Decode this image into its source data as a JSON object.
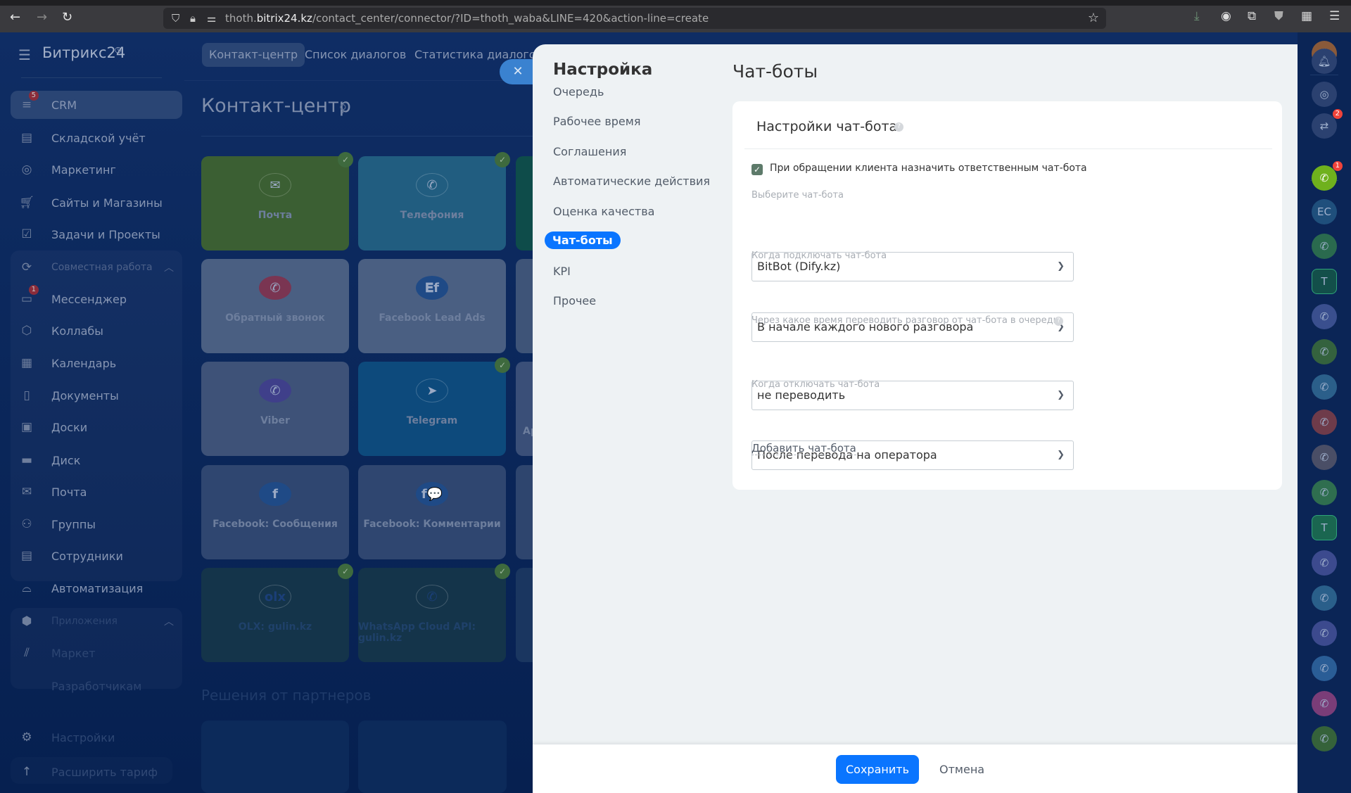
{
  "browser": {
    "url_prefix": "thoth.",
    "url_domain": "bitrix24.kz",
    "url_path": "/contact_center/connector/?ID=thoth_waba&LINE=420&action-line=create"
  },
  "sidebar": {
    "logo": "Битрикс24",
    "items": [
      {
        "label": "CRM",
        "icon": "funnel-icon",
        "badge": "5"
      },
      {
        "label": "Складской учёт",
        "icon": "warehouse-icon"
      },
      {
        "label": "Маркетинг",
        "icon": "target-icon"
      },
      {
        "label": "Сайты и Магазины",
        "icon": "cart-icon"
      },
      {
        "label": "Задачи и Проекты",
        "icon": "task-icon"
      },
      {
        "label": "Совместная работа",
        "icon": "team-icon"
      },
      {
        "label": "Мессенджер",
        "icon": "chat-icon",
        "badge": "1"
      },
      {
        "label": "Коллабы",
        "icon": "hexagon-icon"
      },
      {
        "label": "Календарь",
        "icon": "calendar-icon"
      },
      {
        "label": "Документы",
        "icon": "document-icon"
      },
      {
        "label": "Доски",
        "icon": "board-icon"
      },
      {
        "label": "Диск",
        "icon": "disk-icon"
      },
      {
        "label": "Почта",
        "icon": "mail-icon"
      },
      {
        "label": "Группы",
        "icon": "groups-icon"
      },
      {
        "label": "Сотрудники",
        "icon": "employees-icon"
      },
      {
        "label": "Автоматизация",
        "icon": "robot-icon"
      },
      {
        "label": "Приложения",
        "icon": "box-icon"
      },
      {
        "label": "Маркет",
        "icon": "market-icon"
      },
      {
        "label": "Разработчикам",
        "icon": "code-icon"
      },
      {
        "label": "Настройки",
        "icon": "gear-icon"
      },
      {
        "label": "Расширить тариф",
        "icon": "upgrade-icon"
      }
    ]
  },
  "topnav": {
    "tabs": [
      "Контакт-центр",
      "Список диалогов",
      "Статистика диалогов"
    ]
  },
  "contact_center": {
    "title": "Контакт-центр",
    "partners_title": "Решения от партнеров",
    "tiles": [
      {
        "label": "Почта",
        "color": "#3b5f33",
        "checked": true
      },
      {
        "label": "Телефония",
        "color": "#215d80",
        "checked": true
      },
      {
        "label": "Обратный звонок",
        "color": "#4a5f82",
        "checked": false
      },
      {
        "label": "Facebook Lead Ads",
        "color": "#4a5f82",
        "checked": false
      },
      {
        "label": "Viber",
        "color": "#3e5278",
        "checked": false
      },
      {
        "label": "Telegram",
        "color": "#0d4a7c",
        "checked": true
      },
      {
        "label": "Facebook: Сообщения",
        "color": "#2f4670",
        "checked": false
      },
      {
        "label": "Facebook: Комментарии",
        "color": "#2f4670",
        "checked": false
      },
      {
        "label": "OLX: gulin.kz",
        "color": "#14344a",
        "checked": true
      },
      {
        "label": "WhatsApp Cloud API: gulin.kz",
        "color": "#14344a",
        "checked": true
      }
    ],
    "third_col_partial": "Ap"
  },
  "panel": {
    "title": "Настройка",
    "menu": [
      "Очередь",
      "Рабочее время",
      "Соглашения",
      "Автоматические действия",
      "Оценка качества",
      "Чат-боты",
      "KPI",
      "Прочее"
    ],
    "active_index": 5,
    "section_title": "Чат-боты",
    "card": {
      "title": "Настройки чат-бота",
      "checkbox_label": "При обращении клиента назначить ответственным чат-бота",
      "checkbox_checked": true,
      "fields": [
        {
          "label": "Выберите чат-бота",
          "value": "BitBot (Dify.kz)"
        },
        {
          "label": "Когда подключать чат-бота",
          "value": "В начале каждого нового разговора"
        },
        {
          "label": "Через какое время переводить разговор от чат-бота в очередь",
          "value": "не переводить"
        },
        {
          "label": "Когда отключать чат-бота",
          "value": "После перевода на оператора"
        }
      ],
      "add_link": "Добавить чат-бота"
    },
    "save": "Сохранить",
    "cancel": "Отмена"
  },
  "rightbar": {
    "items": [
      {
        "icon": "bell-icon",
        "color": "#2b4170"
      },
      {
        "icon": "copilot-icon",
        "color": "#2b4170"
      },
      {
        "icon": "chat-sync-icon",
        "color": "#2b4170",
        "badge": "2"
      },
      {
        "icon": "phone-icon",
        "color": "#6fb11d",
        "badge": "1"
      },
      {
        "text": "ЕС",
        "icon": "initials-avatar",
        "color": "#1f4f7c"
      },
      {
        "icon": "phone-icon",
        "color": "#2a6a4e"
      },
      {
        "text": "T",
        "icon": "hexagon-avatar",
        "color": "#134f4a"
      },
      {
        "icon": "phone-icon",
        "color": "#3a4f8e"
      },
      {
        "icon": "phone-icon",
        "color": "#34623e"
      },
      {
        "icon": "phone-icon",
        "color": "#2b5f8a"
      },
      {
        "icon": "phone-icon",
        "color": "#6e3b4a"
      },
      {
        "icon": "phone-icon",
        "color": "#4a4e66"
      },
      {
        "icon": "phone-icon",
        "color": "#2f6e4f"
      },
      {
        "text": "T",
        "icon": "hexagon-avatar",
        "color": "#1a6650"
      },
      {
        "icon": "phone-icon",
        "color": "#3c4a8e"
      },
      {
        "icon": "phone-icon",
        "color": "#2a5f8a"
      },
      {
        "icon": "phone-icon",
        "color": "#3c4a8e"
      },
      {
        "icon": "phone-icon",
        "color": "#2a5d96"
      },
      {
        "icon": "phone-icon",
        "color": "#7a3d78"
      },
      {
        "icon": "phone-icon",
        "color": "#35623a"
      }
    ]
  }
}
